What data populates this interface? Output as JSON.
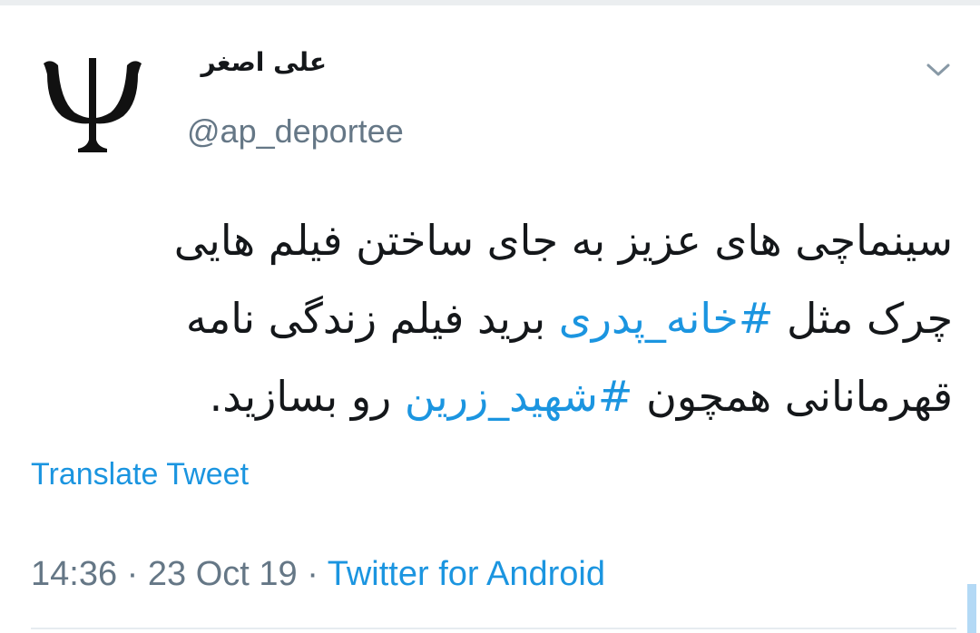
{
  "tweet": {
    "author": {
      "display_name": "علی اصغر",
      "handle": "@ap_deportee",
      "avatar_symbol": "Ψ"
    },
    "menu_icon": "chevron-down-icon",
    "body": {
      "line1": "سینماچی های عزیز به جای ساختن فیلم هایی",
      "line2_pre": "چرک مثل",
      "hashtag1": "#خانه_پدری",
      "line2_post": "برید فیلم زندگی نامه",
      "line3_pre": "قهرمانانی همچون",
      "hashtag2": "#شهید_زرین",
      "line3_post": "رو بسازید."
    },
    "translate_label": "Translate Tweet",
    "time": "14:36",
    "separator": "·",
    "date": "23 Oct 19",
    "source": "Twitter for Android"
  },
  "colors": {
    "link": "#1b95e0",
    "text": "#14171a",
    "muted": "#657786"
  }
}
